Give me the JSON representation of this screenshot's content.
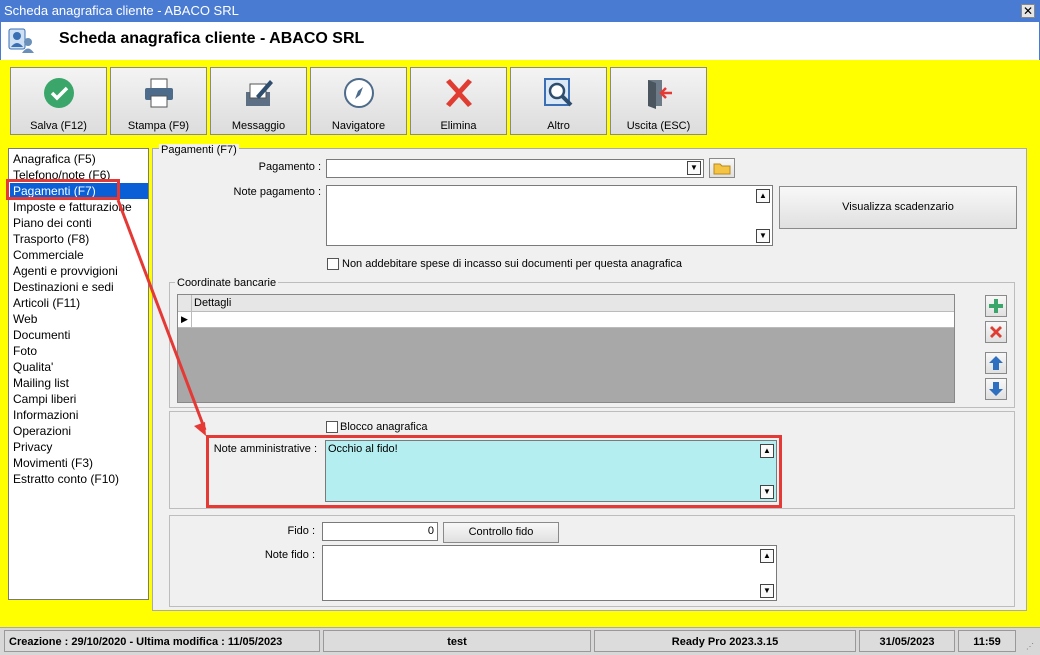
{
  "window": {
    "title": "Scheda anagrafica cliente - ABACO SRL",
    "close_glyph": "✕"
  },
  "header": {
    "title": "Scheda anagrafica cliente - ABACO SRL",
    "icon": "user-card-icon"
  },
  "toolbar": {
    "buttons": [
      {
        "label": "Salva (F12)",
        "icon": "check-icon"
      },
      {
        "label": "Stampa (F9)",
        "icon": "printer-icon"
      },
      {
        "label": "Messaggio",
        "icon": "message-icon"
      },
      {
        "label": "Navigatore",
        "icon": "compass-icon"
      },
      {
        "label": "Elimina",
        "icon": "delete-icon"
      },
      {
        "label": "Altro",
        "icon": "magnifier-icon"
      },
      {
        "label": "Uscita (ESC)",
        "icon": "exit-icon"
      }
    ]
  },
  "sidebar": {
    "selected_index": 2,
    "items": [
      {
        "label": "Anagrafica (F5)"
      },
      {
        "label": "Telefono/note (F6)"
      },
      {
        "label": "Pagamenti (F7)"
      },
      {
        "label": "Imposte e fatturazione"
      },
      {
        "label": "Piano dei conti"
      },
      {
        "label": "Trasporto (F8)"
      },
      {
        "label": "Commerciale"
      },
      {
        "label": "Agenti e provvigioni"
      },
      {
        "label": "Destinazioni e sedi"
      },
      {
        "label": "Articoli (F11)"
      },
      {
        "label": "Web"
      },
      {
        "label": "Documenti"
      },
      {
        "label": "Foto"
      },
      {
        "label": "Qualita'"
      },
      {
        "label": "Mailing list"
      },
      {
        "label": "Campi liberi"
      },
      {
        "label": "Informazioni"
      },
      {
        "label": "Operazioni"
      },
      {
        "label": "Privacy"
      },
      {
        "label": "Movimenti (F3)"
      },
      {
        "label": "Estratto conto (F10)"
      }
    ]
  },
  "pagamenti": {
    "group_label": "Pagamenti (F7)",
    "pagamento_label": "Pagamento :",
    "pagamento_value": "",
    "note_label": "Note pagamento :",
    "note_value": "",
    "visualizza_button": "Visualizza scadenzario",
    "no_spese_checkbox": "Non addebitare spese di incasso sui documenti per questa anagrafica",
    "no_spese_checked": false
  },
  "coordinate": {
    "group_label": "Coordinate bancarie",
    "column_header": "Dettagli",
    "row_marker": "▶"
  },
  "amministrative": {
    "blocco_label": "Blocco anagrafica",
    "blocco_checked": false,
    "note_label": "Note amministrative :",
    "note_value": "Occhio al fido!"
  },
  "fido": {
    "fido_label": "Fido :",
    "fido_value": "0",
    "controllo_button": "Controllo fido",
    "note_label": "Note fido :",
    "note_value": ""
  },
  "status": {
    "creazione": "Creazione : 29/10/2020 - Ultima modifica : 11/05/2023",
    "user": "test",
    "product": "Ready Pro 2023.3.15",
    "date": "31/05/2023",
    "time": "11:59"
  },
  "colors": {
    "accent": "#0a5fd6",
    "highlight_note": "#b4eef0",
    "annotation": "#e53935",
    "background": "#ffff00"
  }
}
